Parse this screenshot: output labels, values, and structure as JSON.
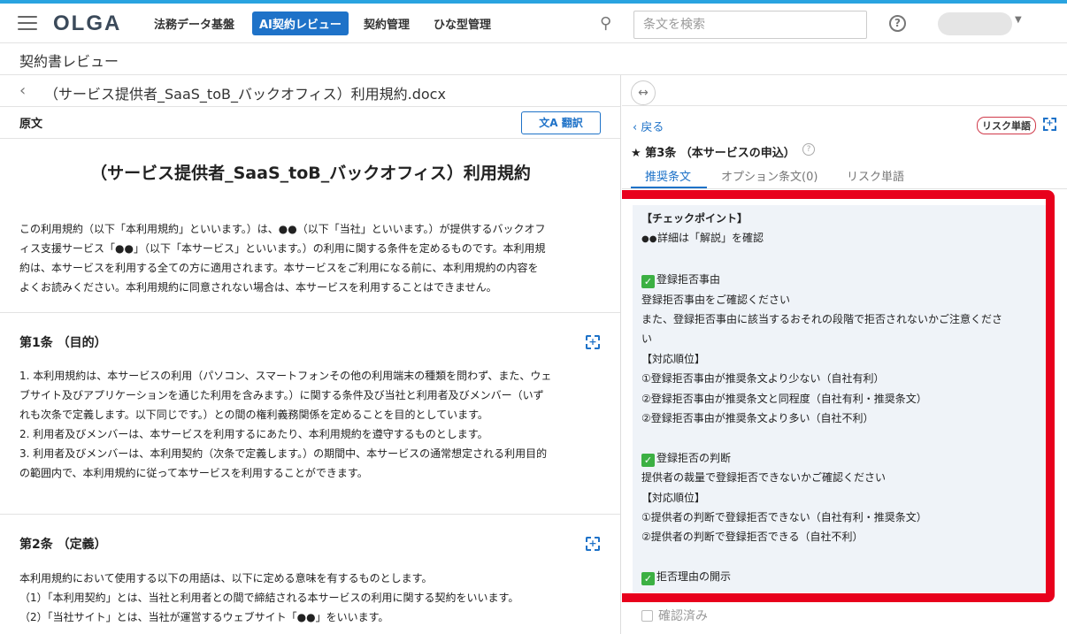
{
  "app": {
    "logo": "OLGA",
    "colors": {
      "accent": "#1e72c8",
      "highlight": "#e8001c",
      "check": "#3cb043"
    }
  },
  "nav": {
    "items": [
      {
        "label": "法務データ基盤"
      },
      {
        "label": "AI契約レビュー"
      },
      {
        "label": "契約管理"
      },
      {
        "label": "ひな型管理"
      }
    ],
    "search_placeholder": "条文を検索"
  },
  "page": {
    "title": "契約書レビュー"
  },
  "document": {
    "filename": "（サービス提供者_SaaS_toB_バックオフィス）利用規約.docx",
    "original_label": "原文",
    "translate_label": "翻訳",
    "title": "（サービス提供者_SaaS_toB_バックオフィス）利用規約",
    "intro": [
      "この利用規約（以下「本利用規約」といいます。）は、●●（以下「当社」といいます。）が提供するバックオフ",
      "ィス支援サービス「●●」（以下「本サービス」といいます。）の利用に関する条件を定めるものです。本利用規",
      "約は、本サービスを利用する全ての方に適用されます。本サービスをご利用になる前に、本利用規約の内容を",
      "よくお読みください。本利用規約に同意されない場合は、本サービスを利用することはできません。"
    ],
    "article1": {
      "heading": "第1条 （目的）",
      "lines": [
        "1. 本利用規約は、本サービスの利用（パソコン、スマートフォンその他の利用端末の種類を問わず、また、ウェ",
        "ブサイト及びアプリケーションを通じた利用を含みます。）に関する条件及び当社と利用者及びメンバー（いず",
        "れも次条で定義します。以下同じです。）との間の権利義務関係を定めることを目的としています。",
        "2. 利用者及びメンバーは、本サービスを利用するにあたり、本利用規約を遵守するものとします。",
        "3. 利用者及びメンバーは、本利用契約（次条で定義します。）の期間中、本サービスの通常想定される利用目的",
        "の範囲内で、本利用規約に従って本サービスを利用することができます。"
      ]
    },
    "article2": {
      "heading": "第2条 （定義）",
      "lines": [
        "本利用規約において使用する以下の用語は、以下に定める意味を有するものとします。",
        "（1）「本利用契約」とは、当社と利用者との間で締結される本サービスの利用に関する契約をいいます。",
        "（2）「当社サイト」とは、当社が運営するウェブサイト「●●」をいいます。"
      ]
    }
  },
  "review": {
    "back_label": "戻る",
    "risk_badge": "リスク単語",
    "clause_title": "第3条 （本サービスの申込）",
    "tabs": [
      {
        "label": "推奨条文"
      },
      {
        "label": "オプション条文(0)"
      },
      {
        "label": "リスク単語"
      }
    ],
    "checkpoint": {
      "heading": "【チェックポイント】",
      "lines": [
        "詳細は「解説」を確認",
        "",
        "登録拒否事由",
        "登録拒否事由をご確認ください",
        "また、登録拒否事由に該当するおそれの段階で拒否されないかご注意くださ",
        "い",
        "【対応順位】",
        "①登録拒否事由が推奨条文より少ない（自社有利）",
        "②登録拒否事由が推奨条文と同程度（自社有利・推奨条文）",
        "②登録拒否事由が推奨条文より多い（自社不利）",
        "",
        "登録拒否の判断",
        "提供者の裁量で登録拒否できないかご確認ください",
        "【対応順位】",
        "①提供者の判断で登録拒否できない（自社有利・推奨条文）",
        "②提供者の判断で登録拒否できる（自社不利）",
        "",
        "拒否理由の開示"
      ]
    },
    "confirm_label": "確認済み"
  }
}
